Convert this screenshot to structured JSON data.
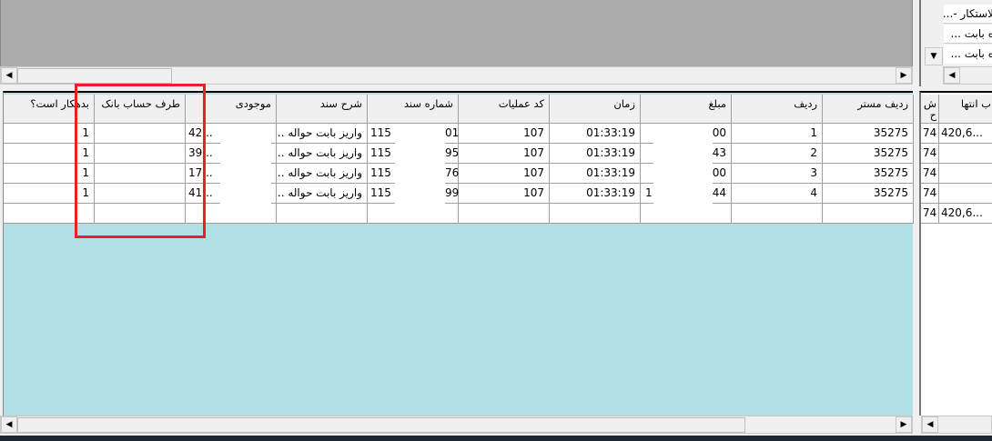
{
  "top_right_list": [
    "لاستکار -...",
    "ه بابت ...",
    "ه بابت ..."
  ],
  "grid": {
    "columns": [
      "ردیف مستر",
      "ردیف",
      "مبلغ",
      "زمان",
      "کد عملیات",
      "شماره سند",
      "شرح سند",
      "موجودی",
      "طرف حساب بانک",
      "بدهکار است؟"
    ],
    "rows": [
      [
        "35275",
        "1",
        "00",
        "01:33:19",
        "107",
        "115",
        "01",
        "واریز بابت حواله ...",
        "42...",
        "1"
      ],
      [
        "35275",
        "2",
        "43",
        "01:33:19",
        "107",
        "115",
        "95",
        "واریز بابت حواله ...",
        "39...",
        "1"
      ],
      [
        "35275",
        "3",
        "00",
        "01:33:19",
        "107",
        "115",
        "76",
        "واریز بابت حواله ...",
        "17...",
        "1"
      ],
      [
        "35275",
        "4",
        "44",
        "01:33:19",
        "107",
        "115",
        "99",
        "واریز بابت حواله ...",
        "41...",
        "1"
      ]
    ],
    "amount_prefix_row4": "1",
    "background_color": "#b0dfe5"
  },
  "right_grid": {
    "columns": [
      "ش ح",
      "ب انتها"
    ],
    "rows": [
      [
        "74",
        "420,6..."
      ],
      [
        "74",
        ""
      ],
      [
        "74",
        ""
      ],
      [
        "74",
        ""
      ],
      [
        "74",
        "420,6..."
      ]
    ]
  },
  "highlight_color": "#e8202a"
}
